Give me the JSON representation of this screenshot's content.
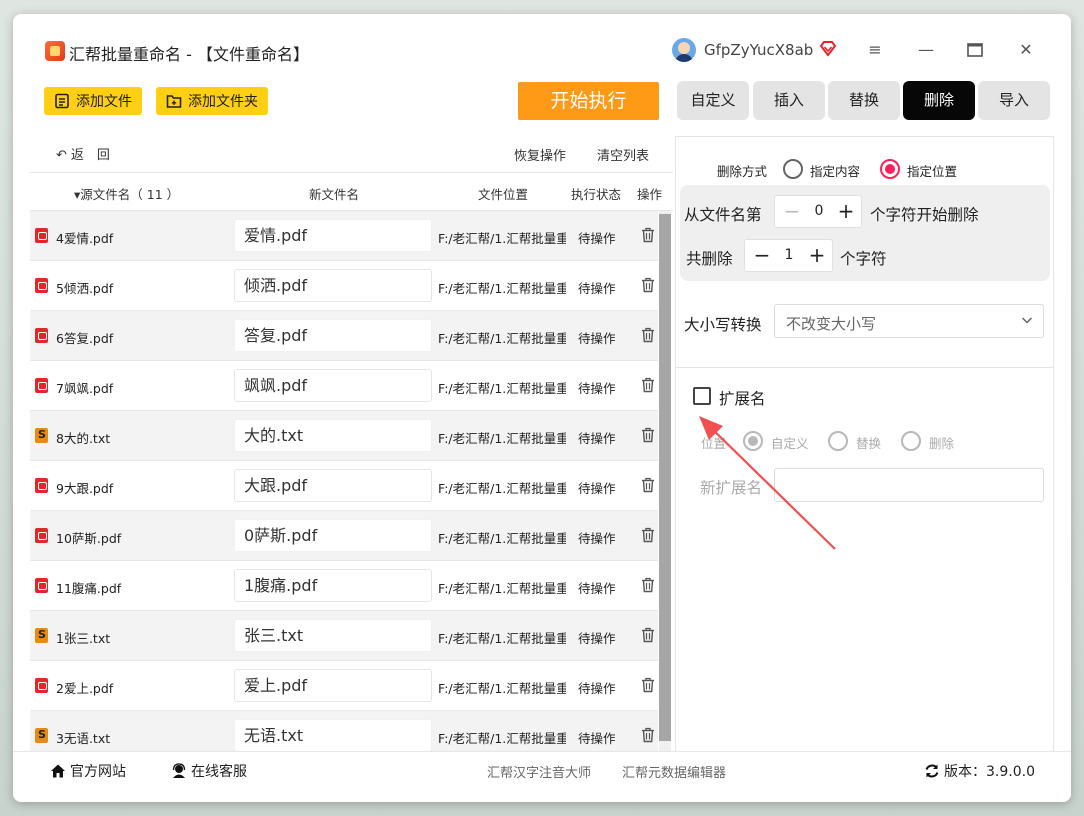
{
  "app": {
    "title": "汇帮批量重命名 - 【文件重命名】",
    "username": "GfpZyYucX8ab"
  },
  "toolbar": {
    "add_file": "添加文件",
    "add_folder": "添加文件夹",
    "start": "开始执行"
  },
  "tabs": [
    {
      "label": "自定义",
      "active": false
    },
    {
      "label": "插入",
      "active": false
    },
    {
      "label": "替换",
      "active": false
    },
    {
      "label": "删除",
      "active": true
    },
    {
      "label": "导入",
      "active": false
    }
  ],
  "list_actions": {
    "back": "返　回",
    "recover": "恢复操作",
    "clear": "清空列表"
  },
  "table": {
    "headers": {
      "source": "▾源文件名（ 11 ）",
      "new_name": "新文件名",
      "location": "文件位置",
      "status": "执行状态",
      "action": "操作"
    },
    "rows": [
      {
        "type": "pdf",
        "source": "4爱情.pdf",
        "new": "爱情.pdf",
        "location": "F:/老汇帮/1.汇帮批量重命名",
        "status": "待操作"
      },
      {
        "type": "pdf",
        "source": "5倾洒.pdf",
        "new": "倾洒.pdf",
        "location": "F:/老汇帮/1.汇帮批量重命名",
        "status": "待操作"
      },
      {
        "type": "pdf",
        "source": "6答复.pdf",
        "new": "答复.pdf",
        "location": "F:/老汇帮/1.汇帮批量重命名",
        "status": "待操作"
      },
      {
        "type": "pdf",
        "source": "7飒飒.pdf",
        "new": "飒飒.pdf",
        "location": "F:/老汇帮/1.汇帮批量重命名",
        "status": "待操作"
      },
      {
        "type": "txt",
        "source": "8大的.txt",
        "new": "大的.txt",
        "location": "F:/老汇帮/1.汇帮批量重命名",
        "status": "待操作"
      },
      {
        "type": "pdf",
        "source": "9大跟.pdf",
        "new": "大跟.pdf",
        "location": "F:/老汇帮/1.汇帮批量重命名",
        "status": "待操作"
      },
      {
        "type": "pdf",
        "source": "10萨斯.pdf",
        "new": "0萨斯.pdf",
        "location": "F:/老汇帮/1.汇帮批量重命名",
        "status": "待操作"
      },
      {
        "type": "pdf",
        "source": "11腹痛.pdf",
        "new": "1腹痛.pdf",
        "location": "F:/老汇帮/1.汇帮批量重命名",
        "status": "待操作"
      },
      {
        "type": "txt",
        "source": "1张三.txt",
        "new": "张三.txt",
        "location": "F:/老汇帮/1.汇帮批量重命名",
        "status": "待操作"
      },
      {
        "type": "pdf",
        "source": "2爱上.pdf",
        "new": "爱上.pdf",
        "location": "F:/老汇帮/1.汇帮批量重命名",
        "status": "待操作"
      },
      {
        "type": "txt",
        "source": "3无语.txt",
        "new": "无语.txt",
        "location": "F:/老汇帮/1.汇帮批量重命名",
        "status": "待操作"
      }
    ]
  },
  "delete_panel": {
    "mode_label": "删除方式",
    "mode_content": "指定内容",
    "mode_position": "指定位置",
    "from_prefix": "从文件名第",
    "from_value": "0",
    "from_suffix": "个字符开始删除",
    "count_prefix": "共删除",
    "count_value": "1",
    "count_suffix": "个字符",
    "case_label": "大小写转换",
    "case_value": "不改变大小写",
    "ext_checkbox": "扩展名",
    "ext_position_label": "位置",
    "ext_custom": "自定义",
    "ext_replace": "替换",
    "ext_delete": "删除",
    "ext_new_label": "新扩展名"
  },
  "footer": {
    "website": "官方网站",
    "support": "在线客服",
    "link1": "汇帮汉字注音大师",
    "link2": "汇帮元数据编辑器",
    "version": "版本：3.9.0.0"
  },
  "colors": {
    "accent_yellow": "#ffcf14",
    "start_orange": "#ff9a17",
    "radio_active": "#ff1f5a",
    "arrow_red": "#f05050"
  }
}
